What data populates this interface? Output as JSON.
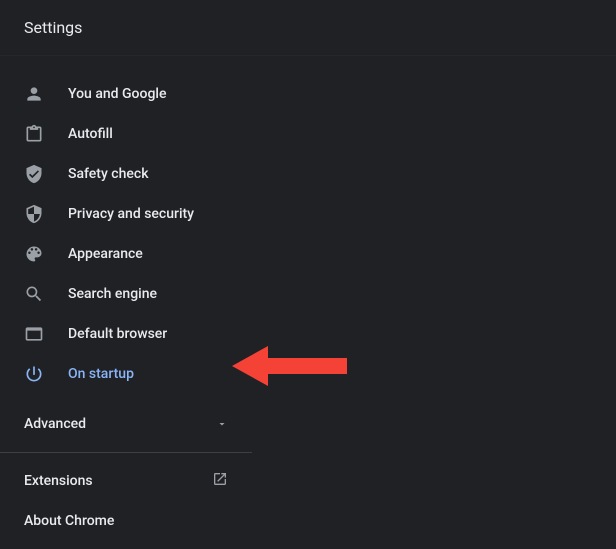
{
  "header": {
    "title": "Settings"
  },
  "nav": {
    "items": [
      {
        "label": "You and Google"
      },
      {
        "label": "Autofill"
      },
      {
        "label": "Safety check"
      },
      {
        "label": "Privacy and security"
      },
      {
        "label": "Appearance"
      },
      {
        "label": "Search engine"
      },
      {
        "label": "Default browser"
      },
      {
        "label": "On startup"
      }
    ],
    "advanced": {
      "label": "Advanced"
    },
    "extensions": {
      "label": "Extensions"
    },
    "about": {
      "label": "About Chrome"
    }
  },
  "colors": {
    "background": "#202124",
    "text": "#e8eaed",
    "muted_icon": "#9aa0a6",
    "accent": "#8ab4f8",
    "annotation_arrow": "#f44336"
  }
}
